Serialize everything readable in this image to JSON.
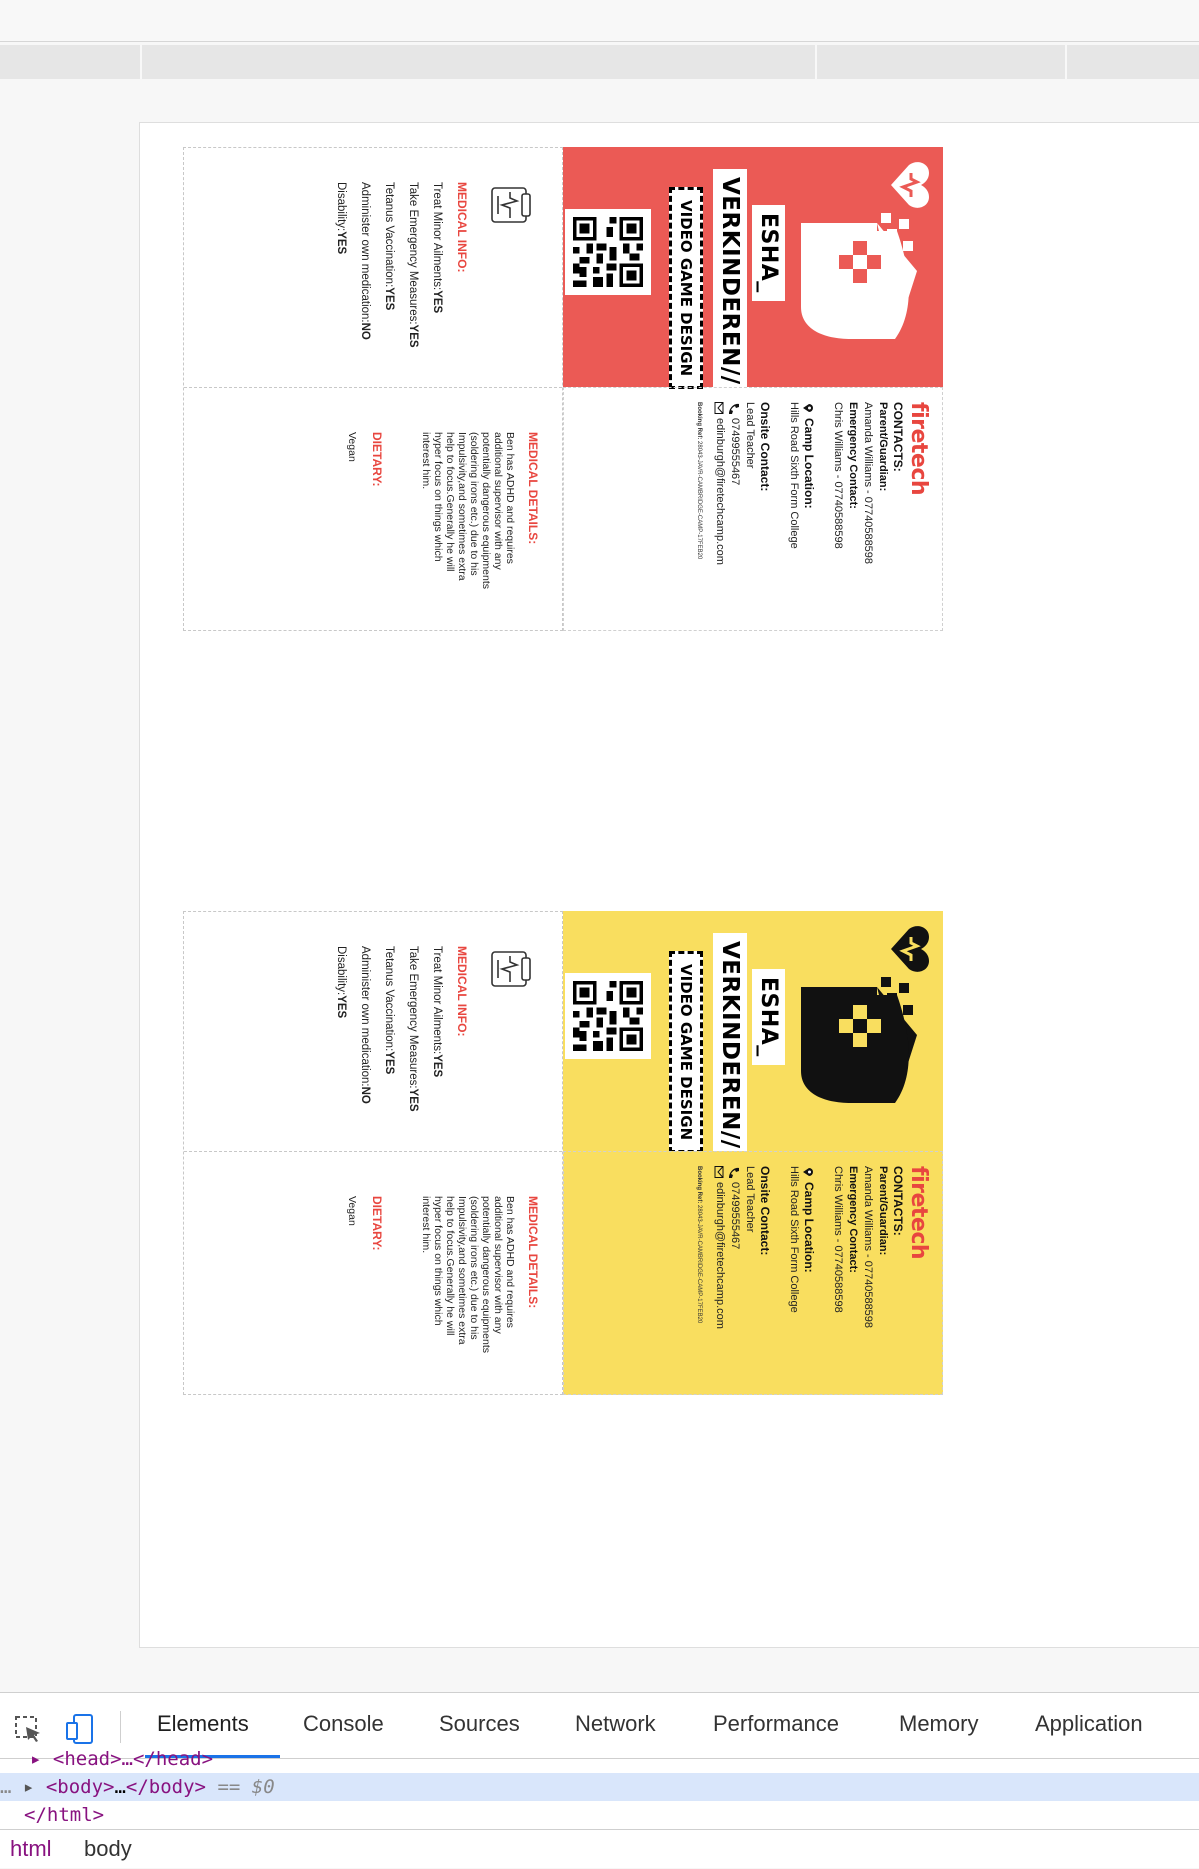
{
  "cards": [
    {
      "theme": "red",
      "bg": "#eb5a55",
      "mascot_color": "#ffffff",
      "name": "ESHA_",
      "surname": "VERKINDEREN//",
      "course": "VIDEO GAME DESIGN",
      "brand": "firetech",
      "contacts_heading": "CONTACTS:",
      "parent_label": "Parent/Guardian:",
      "parent_value": "Amanda Williams - 07740588598",
      "emergency_label": "Emergency Contact:",
      "emergency_value": "Chris Williams - 07740588598",
      "camp_label": "Camp Location:",
      "camp_value": "Hills Road Sixth Form College",
      "onsite_label": "Onsite Contact:",
      "onsite_value": "Lead Teacher",
      "phone": "07499555467",
      "email": "edinburgh@firetechcamp.com",
      "booking_label": "Booking Ref:",
      "booking_value": "28043-JAVR-CAMBRIDGE-CAMP-17FEB20",
      "medical_info_heading": "MEDICAL INFO:",
      "minor_label": "Treat Minor Ailments:",
      "minor_value": "YES",
      "emergency_measures_label": "Take Emergency Measures:",
      "emergency_measures_value": "YES",
      "tetanus_label": "Tetanus Vaccination:",
      "tetanus_value": "YES",
      "own_med_label": "Administer own medication:",
      "own_med_value": "NO",
      "disability_label": "Disability:",
      "disability_value": "YES",
      "medical_details_heading": "MEDICAL DETAILS:",
      "medical_details_text": "Ben has ADHD and requires additional supervisor with any potentially dangerous equipments (soldering irons etc.) due to his Impulsivity,and sometimes extra help to focus.Generally he will hyper focus on things which interest him.",
      "dietary_heading": "DIETARY:",
      "dietary_value": "Vegan"
    },
    {
      "theme": "yellow",
      "bg": "#f9de5f",
      "mascot_color": "#111111",
      "name": "ESHA_",
      "surname": "VERKINDEREN//",
      "course": "VIDEO GAME DESIGN",
      "brand": "firetech",
      "contacts_heading": "CONTACTS:",
      "parent_label": "Parent/Guardian:",
      "parent_value": "Amanda Williams - 07740588598",
      "emergency_label": "Emergency Contact:",
      "emergency_value": "Chris Williams - 07740588598",
      "camp_label": "Camp Location:",
      "camp_value": "Hills Road Sixth Form College",
      "onsite_label": "Onsite Contact:",
      "onsite_value": "Lead Teacher",
      "phone": "07499555467",
      "email": "edinburgh@firetechcamp.com",
      "booking_label": "Booking Ref:",
      "booking_value": "28043-JAVR-CAMBRIDGE-CAMP-17FEB20",
      "medical_info_heading": "MEDICAL INFO:",
      "minor_label": "Treat Minor Ailments:",
      "minor_value": "YES",
      "emergency_measures_label": "Take Emergency Measures:",
      "emergency_measures_value": "YES",
      "tetanus_label": "Tetanus Vaccination:",
      "tetanus_value": "YES",
      "own_med_label": "Administer own medication:",
      "own_med_value": "NO",
      "disability_label": "Disability:",
      "disability_value": "YES",
      "medical_details_heading": "MEDICAL DETAILS:",
      "medical_details_text": "Ben has ADHD and requires additional supervisor with any potentially dangerous equipments (soldering irons etc.) due to his Impulsivity,and sometimes extra help to focus.Generally he will hyper focus on things which interest him.",
      "dietary_heading": "DIETARY:",
      "dietary_value": "Vegan"
    }
  ],
  "devtools": {
    "tabs": [
      "Elements",
      "Console",
      "Sources",
      "Network",
      "Performance",
      "Memory",
      "Application"
    ],
    "active_tab": "Elements",
    "head_line": "<head>…</head>",
    "body_open": "<body>",
    "body_ellipsis": "…",
    "body_close": "</body>",
    "eq": "== $0",
    "html_close": "</html>",
    "dots": "…",
    "breadcrumbs": [
      "html",
      "body"
    ]
  },
  "colors": {
    "brand_red": "#e8463f",
    "devtools_accent": "#1a73e8"
  }
}
